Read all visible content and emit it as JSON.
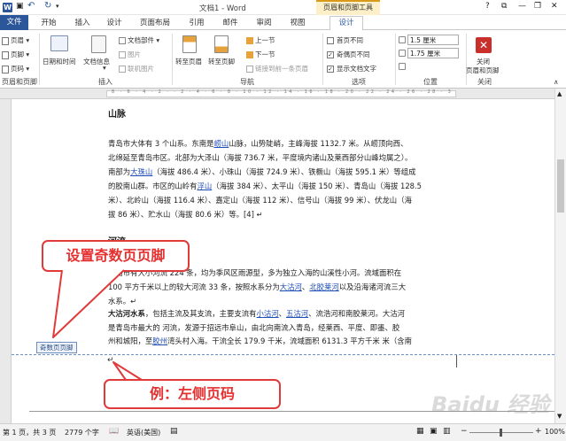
{
  "window": {
    "title": "文档1 - Word",
    "context_tab": "页眉和页脚工具",
    "help": "?",
    "minimize": "—",
    "restore": "❐",
    "close": "✕"
  },
  "quick_access": {
    "save": "💾",
    "undo": "↶",
    "redo": "↻"
  },
  "tabs": [
    "文件",
    "开始",
    "插入",
    "设计",
    "页面布局",
    "引用",
    "邮件",
    "审阅",
    "视图",
    "设计"
  ],
  "ribbon": {
    "header_footer": {
      "header": "页眉",
      "footer": "页脚",
      "page_number": "页码",
      "group": "页眉和页脚"
    },
    "insert": {
      "datetime": "日期和时间",
      "docinfo": "文档信息",
      "docparts": "文档部件",
      "picture": "图片",
      "online_picture": "联机图片",
      "group": "插入"
    },
    "nav": {
      "goto_header": "转至页眉",
      "goto_footer": "转至页脚",
      "prev": "上一节",
      "next": "下一节",
      "link_prev": "链接到前一条页眉",
      "group": "导航"
    },
    "options": {
      "diff_first": "首页不同",
      "diff_odd_even": "奇偶页不同",
      "show_text": "显示文档文字",
      "group": "选项"
    },
    "position": {
      "header_top": "1.5 厘米",
      "footer_bottom": "1.75 厘米",
      "group": "位置"
    },
    "close": {
      "label1": "关闭",
      "label2": "页眉和页脚",
      "group": "关闭"
    }
  },
  "document": {
    "heading1": "山脉",
    "p1": [
      [
        "青岛市大体有 3 个山系。东南是",
        "崂山",
        "山脉，山势陡峭，主峰海拔 1132.7 米。从崂顶向西、"
      ],
      [
        "北绵延至青岛市区。北部为大泽山（海拔 736.7 米，平度境内诸山及莱西部分山峰均属之）。"
      ],
      [
        "南部为",
        "大珠山",
        "（海拔 486.4 米）、小珠山（海拔 724.9 米）、铁橛山（海拔 595.1 米）等组成"
      ],
      [
        "的胶南山群。市区的山岭有",
        "浮山",
        "（海拔 384 米）、太平山（海拔 150 米）、青岛山（海拔 128.5"
      ],
      [
        "米）、北岭山（海拔 116.4 米）、嘉定山（海拔 112 米）、信号山（海拔 99 米）、伏龙山（海"
      ],
      [
        "拔 86 米）、贮水山（海拔 80.6 米）等。[4] ↵"
      ]
    ],
    "heading2": "河流",
    "p2": [
      [
        "青岛市有大小河流 224 条，均为季风区雨源型，多为独立入海的山溪性小河。流域面积在"
      ],
      [
        "100 平方千米以上的较大河流 33 条，按照水系分为",
        "大沽河",
        "、",
        "北胶莱河",
        "以及沿海诸河流三大"
      ],
      [
        "水系。↵"
      ]
    ],
    "p3": [
      [
        "大沽河水系",
        "，包括主流及其支流，主要支流有",
        "小沽河",
        "、",
        "五沽河",
        "、流浩河和南胶莱河。大沽河"
      ],
      [
        "是青岛市最大的  河流，发源于招远市阜山，由北向南流入青岛，经莱西、平度、即墨、胶"
      ],
      [
        "州和城阳，至",
        "胶州",
        "湾头村入海。干流全长 179.9 千米，流域面积 6131.3 平方千米  米（含南"
      ]
    ],
    "footer_tag": "奇数页页脚",
    "cursor": "↵"
  },
  "callouts": {
    "top": "设置奇数页页脚",
    "bottom": "例：左侧页码"
  },
  "status": {
    "page": "第 1 页，共 3 页",
    "words": "2779 个字",
    "lang": "英语(美国)",
    "zoom": "100%"
  },
  "watermark": "Baidu 经验"
}
